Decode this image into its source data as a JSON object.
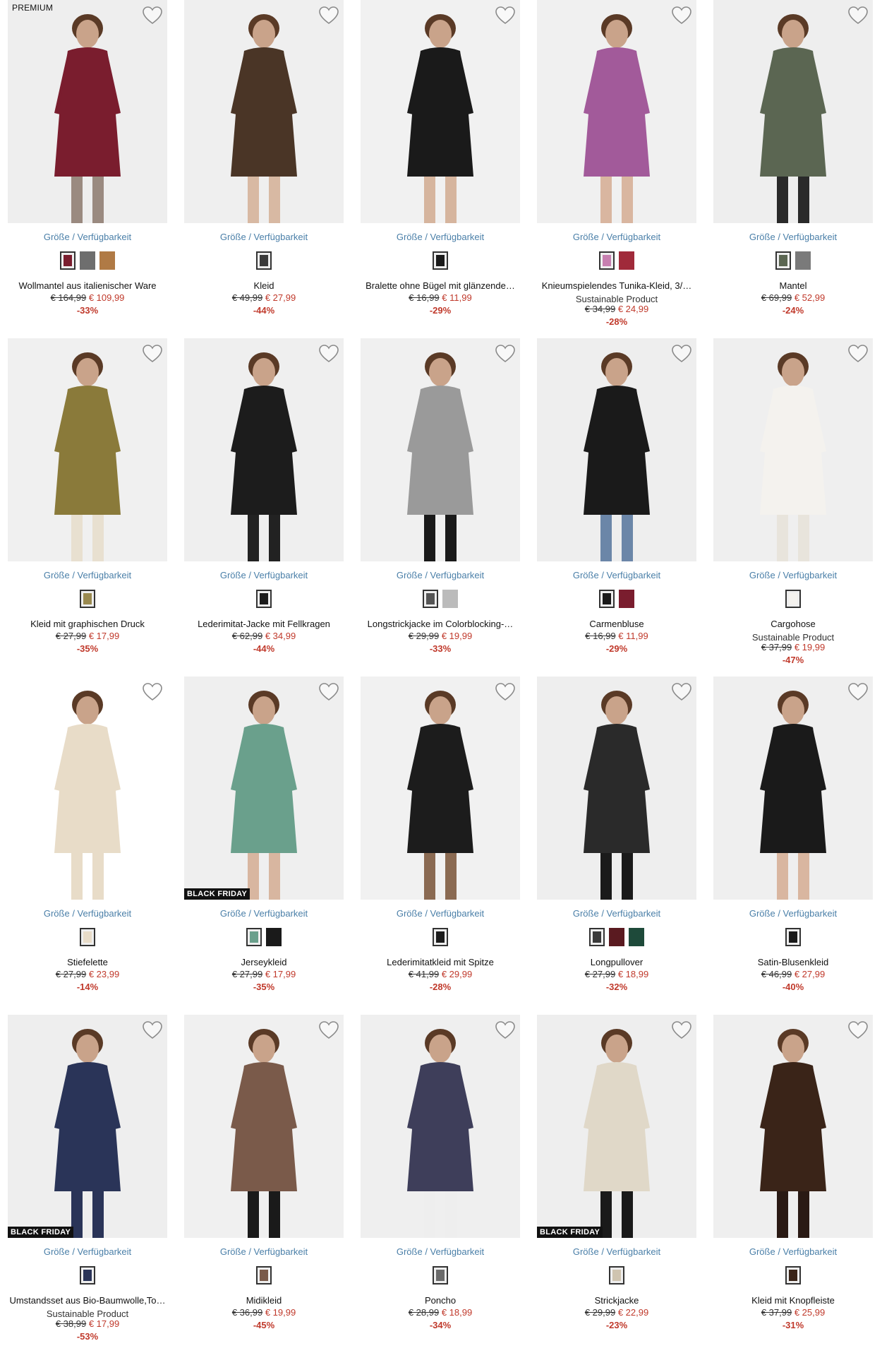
{
  "labels": {
    "size_link": "Größe / Verfügbarkeit",
    "premium": "PREMIUM",
    "black_friday": "BLACK FRIDAY"
  },
  "products": [
    {
      "name": "Wollmantel aus italienischer Ware",
      "sub": "",
      "old": "€ 164,99",
      "new": "€ 109,99",
      "discount": "-33%",
      "badge": "PREMIUM",
      "bg": "#eeeeee",
      "figure": "#7a1d2e",
      "legs": "#9a8a80",
      "swatches": [
        "#7a1d2e",
        "#6e6e6e",
        "#b07a45"
      ]
    },
    {
      "name": "Kleid",
      "sub": "",
      "old": "€ 49,99",
      "new": "€ 27,99",
      "discount": "-44%",
      "badge": "",
      "bg": "#efefef",
      "figure": "#4a3526",
      "legs": "#d8b9a3",
      "swatches": [
        "#3b3b3b"
      ]
    },
    {
      "name": "Bralette ohne Bügel mit glänzende…",
      "sub": "",
      "old": "€ 16,99",
      "new": "€ 11,99",
      "discount": "-29%",
      "badge": "",
      "bg": "#f1f1f1",
      "figure": "#1a1a1a",
      "legs": "#d6b59e",
      "swatches": [
        "#1a1a1a"
      ]
    },
    {
      "name": "Knieumspielendes Tunika-Kleid, 3/…",
      "sub": "Sustainable Product",
      "old": "€ 34,99",
      "new": "€ 24,99",
      "discount": "-28%",
      "badge": "",
      "bg": "#f0f0f0",
      "figure": "#a25a9a",
      "legs": "#d9b6a0",
      "swatches": [
        "#c77fb0",
        "#a02a3a"
      ]
    },
    {
      "name": "Mantel",
      "sub": "",
      "old": "€ 69,99",
      "new": "€ 52,99",
      "discount": "-24%",
      "badge": "",
      "bg": "#eeeeee",
      "figure": "#5b6652",
      "legs": "#2a2a2a",
      "swatches": [
        "#5b6652",
        "#7a7a7a"
      ]
    },
    {
      "name": "Kleid mit graphischen Druck",
      "sub": "",
      "old": "€ 27,99",
      "new": "€ 17,99",
      "discount": "-35%",
      "badge": "",
      "bg": "#f0f0f0",
      "figure": "#8a7a3a",
      "legs": "#e8e0d0",
      "swatches": [
        "#9a8a50"
      ]
    },
    {
      "name": "Lederimitat-Jacke mit Fellkragen",
      "sub": "",
      "old": "€ 62,99",
      "new": "€ 34,99",
      "discount": "-44%",
      "badge": "",
      "bg": "#efefef",
      "figure": "#1c1c1c",
      "legs": "#222222",
      "swatches": [
        "#1c1c1c"
      ]
    },
    {
      "name": "Longstrickjacke im Colorblocking-…",
      "sub": "",
      "old": "€ 29,99",
      "new": "€ 19,99",
      "discount": "-33%",
      "badge": "",
      "bg": "#f0f0f0",
      "figure": "#9a9a9a",
      "legs": "#1a1a1a",
      "swatches": [
        "#555555",
        "#bbbbbb"
      ]
    },
    {
      "name": "Carmenbluse",
      "sub": "",
      "old": "€ 16,99",
      "new": "€ 11,99",
      "discount": "-29%",
      "badge": "",
      "bg": "#eeeeee",
      "figure": "#1a1a1a",
      "legs": "#6b86a8",
      "swatches": [
        "#1a1a1a",
        "#7a1d2e"
      ]
    },
    {
      "name": "Cargohose",
      "sub": "Sustainable Product",
      "old": "€ 37,99",
      "new": "€ 19,99",
      "discount": "-47%",
      "badge": "",
      "bg": "#efefef",
      "figure": "#f4f2ee",
      "legs": "#e8e4dc",
      "swatches": [
        "#f4f2ee"
      ]
    },
    {
      "name": "Stiefelette",
      "sub": "",
      "old": "€ 27,99",
      "new": "€ 23,99",
      "discount": "-14%",
      "badge": "",
      "bg": "#ffffff",
      "figure": "#e8dcc8",
      "legs": "#e8dcc8",
      "swatches": [
        "#e8dcc8"
      ]
    },
    {
      "name": "Jerseykleid",
      "sub": "",
      "old": "€ 27,99",
      "new": "€ 17,99",
      "discount": "-35%",
      "badge": "BLACK FRIDAY",
      "bg": "#efefef",
      "figure": "#6aa08c",
      "legs": "#d8b6a0",
      "swatches": [
        "#6aa08c",
        "#1a1a1a"
      ]
    },
    {
      "name": "Lederimitatkleid mit Spitze",
      "sub": "",
      "old": "€ 41,99",
      "new": "€ 29,99",
      "discount": "-28%",
      "badge": "",
      "bg": "#f1f1f1",
      "figure": "#1c1c1c",
      "legs": "#8a6a52",
      "swatches": [
        "#1c1c1c"
      ]
    },
    {
      "name": "Longpullover",
      "sub": "",
      "old": "€ 27,99",
      "new": "€ 18,99",
      "discount": "-32%",
      "badge": "",
      "bg": "#eeeeee",
      "figure": "#2a2a2a",
      "legs": "#1a1a1a",
      "swatches": [
        "#3a3a3a",
        "#5a1a20",
        "#1e4a3a"
      ]
    },
    {
      "name": "Satin-Blusenkleid",
      "sub": "",
      "old": "€ 46,99",
      "new": "€ 27,99",
      "discount": "-40%",
      "badge": "",
      "bg": "#efefef",
      "figure": "#1a1a1a",
      "legs": "#d9b6a0",
      "swatches": [
        "#1a1a1a"
      ]
    },
    {
      "name": "Umstandsset aus Bio-Baumwolle,To…",
      "sub": "Sustainable Product",
      "old": "€ 38,99",
      "new": "€ 17,99",
      "discount": "-53%",
      "badge": "BLACK FRIDAY",
      "bg": "#eeeeee",
      "figure": "#2a3458",
      "legs": "#2a3458",
      "swatches": [
        "#2a3458"
      ]
    },
    {
      "name": "Midikleid",
      "sub": "",
      "old": "€ 36,99",
      "new": "€ 19,99",
      "discount": "-45%",
      "badge": "",
      "bg": "#f0f0f0",
      "figure": "#7a5a4a",
      "legs": "#1a1a1a",
      "swatches": [
        "#7a5a4a"
      ]
    },
    {
      "name": "Poncho",
      "sub": "",
      "old": "€ 28,99",
      "new": "€ 18,99",
      "discount": "-34%",
      "badge": "",
      "bg": "#efefef",
      "figure": "#3e3e5a",
      "legs": "#eeeeee",
      "swatches": [
        "#6a6a6a"
      ]
    },
    {
      "name": "Strickjacke",
      "sub": "",
      "old": "€ 29,99",
      "new": "€ 22,99",
      "discount": "-23%",
      "badge": "BLACK FRIDAY",
      "bg": "#eeeeee",
      "figure": "#e0d8c8",
      "legs": "#1a1a1a",
      "swatches": [
        "#cfc4b0"
      ]
    },
    {
      "name": "Kleid mit Knopfleiste",
      "sub": "",
      "old": "€ 37,99",
      "new": "€ 25,99",
      "discount": "-31%",
      "badge": "",
      "bg": "#efefef",
      "figure": "#3a2418",
      "legs": "#2a1a14",
      "swatches": [
        "#3a2418"
      ]
    }
  ]
}
